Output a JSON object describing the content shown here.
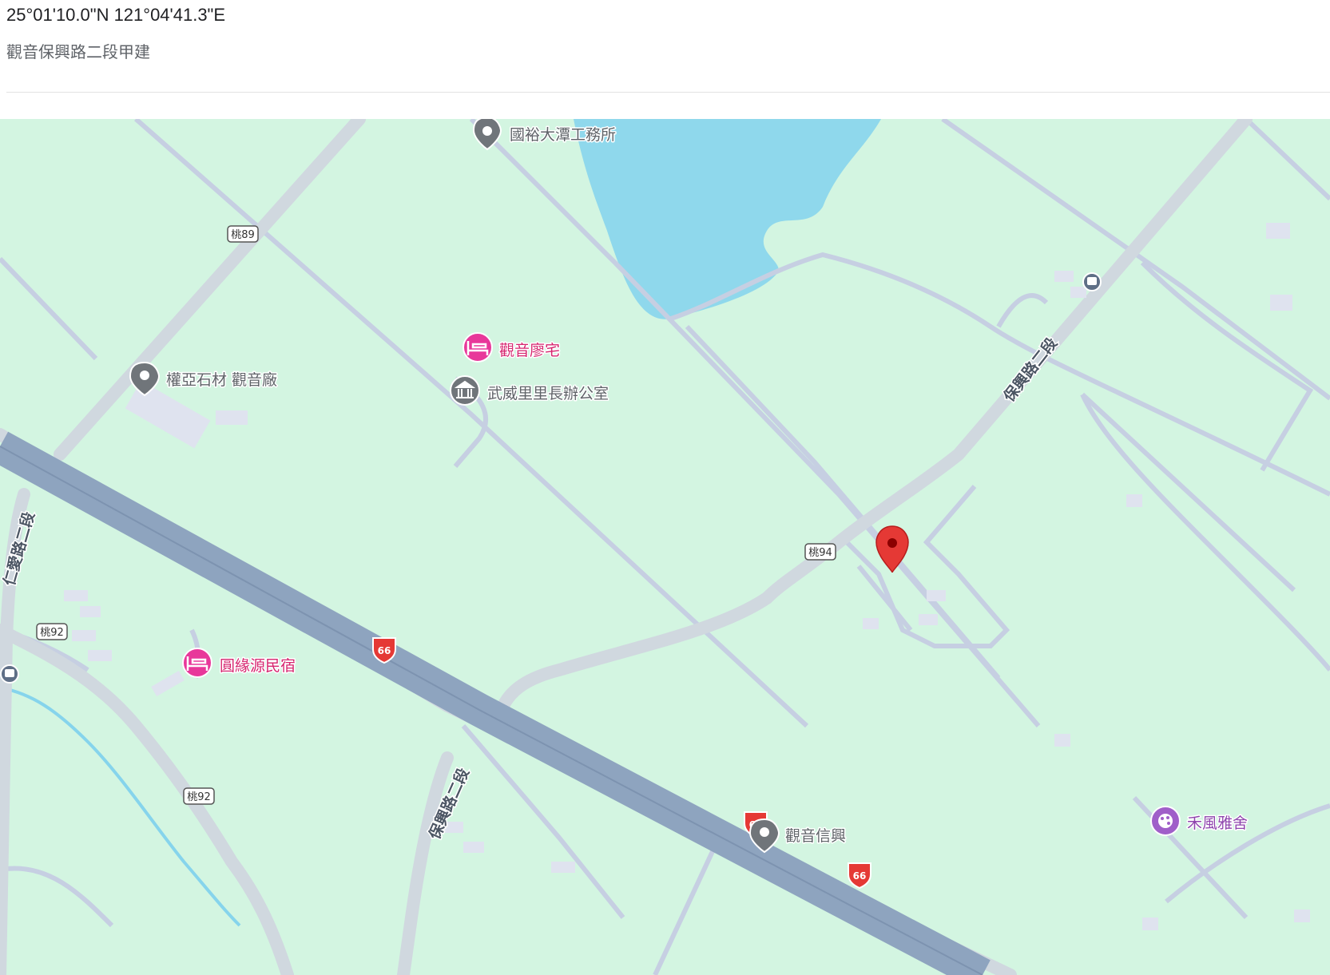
{
  "coordinates": "25°01'10.0\"N 121°04'41.3\"E",
  "place_name": "觀音保興路二段甲建",
  "map": {
    "pois": [
      {
        "name": "國裕大潭工務所",
        "category": "place-marker-icon",
        "style": "gray"
      },
      {
        "name": "觀音廖宅",
        "category": "lodging-icon",
        "style": "pink"
      },
      {
        "name": "武威里里長辦公室",
        "category": "government-building-icon",
        "style": "gray"
      },
      {
        "name": "權亞石材 觀音廠",
        "category": "place-marker-icon",
        "style": "gray"
      },
      {
        "name": "圓緣源民宿",
        "category": "lodging-icon",
        "style": "pink"
      },
      {
        "name": "觀音信興",
        "category": "place-marker-icon",
        "style": "gray"
      },
      {
        "name": "禾風雅舍",
        "category": "arts-palette-icon",
        "style": "purple"
      }
    ],
    "road_labels": [
      "保興路二段",
      "保興路二段",
      "仁愛路二段"
    ],
    "road_shields": [
      "桃89",
      "桃94",
      "桃92",
      "桃92"
    ],
    "highway_shields": [
      "66",
      "66",
      "66"
    ],
    "selected_pin": "red-location-pin-icon",
    "colors": {
      "land": "#d3f5e1",
      "water": "#8fd8ec",
      "road": "#d0d8df",
      "highway": "#8ea4bf",
      "pin": "#e53935",
      "lodging": "#e8389a",
      "poi_gray": "#70757a",
      "arts": "#a05fc9"
    }
  }
}
